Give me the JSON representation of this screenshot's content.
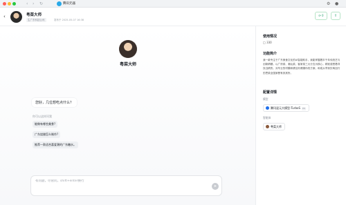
{
  "browser": {
    "tab_title": "腾讯元器",
    "nav_back": "‹",
    "nav_forward": "›",
    "nav_reload": "↻",
    "menu_icon": "⋯",
    "extension_icon": "⚙",
    "profile_icon": "●"
  },
  "header": {
    "back_glyph": "‹",
    "bot_name": "粤菜大师",
    "badge": "生广东科技公司",
    "meta": "发布于 2025-05-07 16:38",
    "count": "⟳ 0",
    "share_glyph": "⇪"
  },
  "chat": {
    "bot_name": "粤菜大师",
    "greeting": "您好，几位想吃点什么？",
    "suggestions_label": "你可以这样问我",
    "suggestions": [
      "能做有哪些美食?",
      "广东烧腊怎么制作?",
      "推荐一款适合喜爱潮的广东糖水。"
    ],
    "input_placeholder": "有问题，尽管问，shift+enter换行",
    "send_glyph": "➤"
  },
  "panel": {
    "usage_title": "使用情况",
    "usage_icon": "□",
    "usage_count": "330",
    "intro_title": "功能简介",
    "intro_text": "我一款专注于广东美食文化的AI智能助手，我能掌握着丰千年传统艺与创新精髓，以广府菜、潮汕菜、客家菜三大分支为核心，精准感受着寻找当精的，对专业的材模和健议你健康你改方案，和成从早到饮粤加行的思菜全国家餐有其其所。",
    "config_title": "配置详情",
    "model_label": "模型",
    "model_name": "腾讯混元大模型-TurboS",
    "model_tag": "DS",
    "plugin_label": "智能体",
    "plugin_name": "粤菜大师"
  },
  "colors": {
    "accent_green": "#22a06b",
    "model_dot": "#1f6feb",
    "plugin_dot": "#8b5a3c"
  }
}
